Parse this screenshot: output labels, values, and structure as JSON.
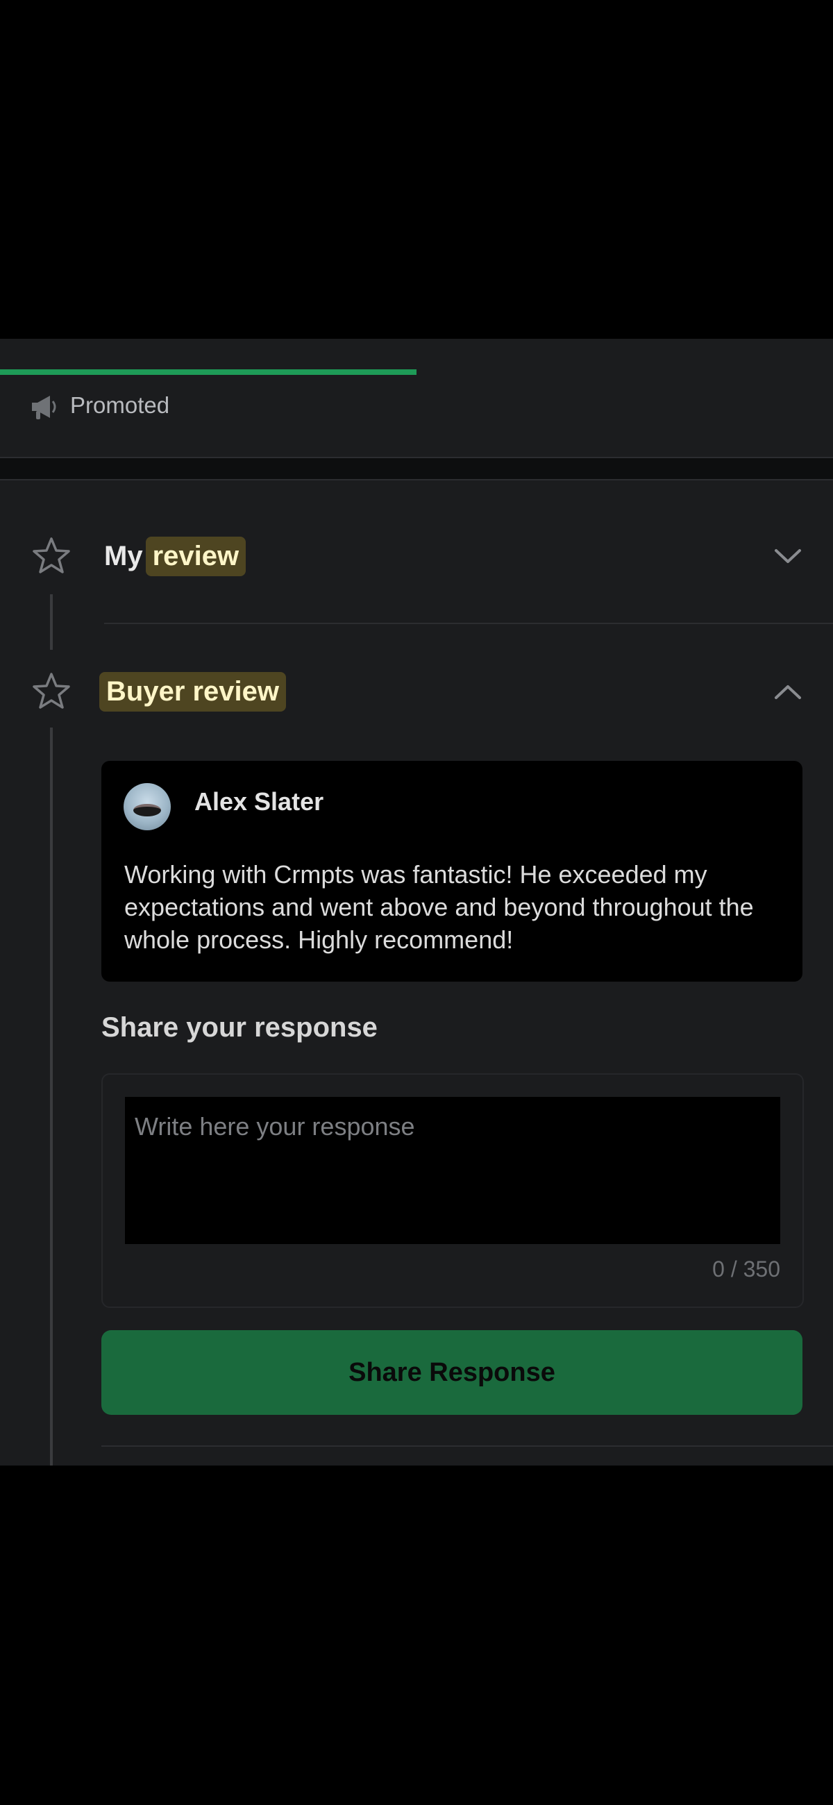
{
  "promo": {
    "label": "Promoted",
    "progress_fraction": 0.5,
    "progress_color": "#1e9a57",
    "icon": "megaphone-icon"
  },
  "sections": {
    "my_review": {
      "prefix": "My",
      "highlight": "review",
      "expanded": false,
      "icon": "star-outline-icon"
    },
    "buyer_review": {
      "title": "Buyer review",
      "expanded": true,
      "icon": "star-outline-icon"
    }
  },
  "review": {
    "reviewer_name": "Alex Slater",
    "text": "Working with Crmpts was fantastic! He exceeded my expectations and went above and beyond throughout the whole process. Highly recommend!"
  },
  "response": {
    "heading": "Share your response",
    "placeholder": "Write here your response",
    "value": "",
    "char_count": "0 / 350",
    "button_label": "Share Response"
  },
  "colors": {
    "accent_green": "#1e9a57",
    "button_green": "#1a6a3d",
    "highlight_bg": "#4e4521",
    "highlight_text": "#fff6c8"
  }
}
